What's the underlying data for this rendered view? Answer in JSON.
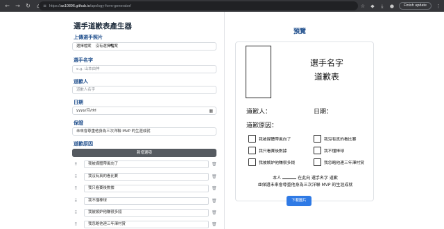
{
  "browser": {
    "url_prefix": "https://",
    "url_host": "as10896.github.io",
    "url_path": "/apology-form-generator/",
    "finish_update": "Finish update"
  },
  "form": {
    "title": "選手道歉表產生器",
    "photo": {
      "label": "上傳選手照片",
      "button": "選擇檔案",
      "status": "沒有選擇檔案"
    },
    "name": {
      "label": "選手名字",
      "placeholder": "e.g. 山本由伸"
    },
    "apologizer": {
      "label": "道歉人",
      "placeholder": "道歉人名字"
    },
    "date": {
      "label": "日期",
      "placeholder": "yyyy/月/dd"
    },
    "promise": {
      "label": "保證",
      "value": "未來會尊重他身為三次洋聯 MVP 的生涯成就"
    },
    "reasons": {
      "label": "道歉原因",
      "add_button": "新增選項",
      "items": [
        "我被媒體帶風向了",
        "我沒有真的看比賽",
        "我只看賽後數據",
        "我不懂棒球",
        "我被嫉妒他賺很多錢",
        "我忽略他連三年澤村賞"
      ]
    }
  },
  "preview": {
    "title": "預覽",
    "player_name": "選手名字",
    "doc_title": "道歉表",
    "apologizer_label": "道歉人：",
    "date_label": "日期：",
    "reason_label": "道歉原因：",
    "reasons": [
      "我被媒體帶風向了",
      "我沒有真的看比賽",
      "我只看賽後數據",
      "我不懂棒球",
      "我被嫉妒他賺很多錢",
      "我忽略他連三年澤村賞"
    ],
    "sig_prefix": "本人",
    "sig_suffix": "在此向 選手名字 道歉",
    "promise_line": "並保證未來會尊重他身為三次洋聯 MVP 的生涯成就",
    "download_button": "下載圖片"
  }
}
